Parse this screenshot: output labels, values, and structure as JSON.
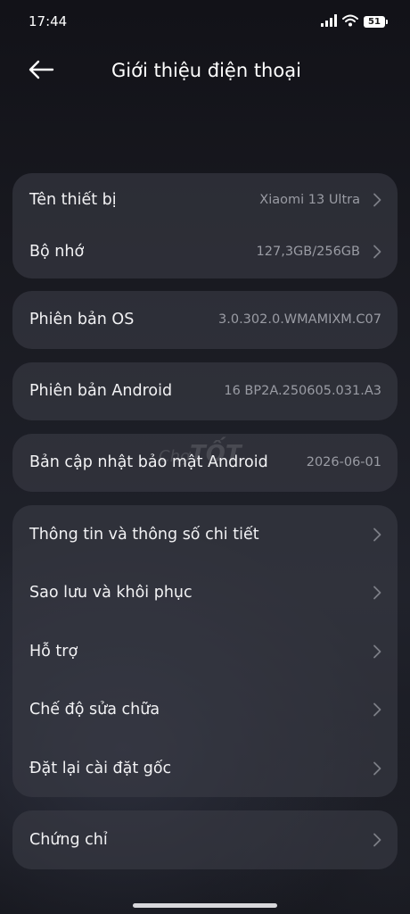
{
  "status_bar": {
    "time": "17:44",
    "battery_level": "51",
    "icons": [
      "signal-icon",
      "wifi-icon",
      "battery-icon"
    ]
  },
  "header": {
    "back_icon": "arrow-left-icon",
    "title": "Giới thiệu điện thoại"
  },
  "cards": {
    "device": {
      "rows": [
        {
          "label": "Tên thiết bị",
          "value": "Xiaomi 13 Ultra"
        },
        {
          "label": "Bộ nhớ",
          "value": "127,3GB/256GB"
        }
      ]
    },
    "os": {
      "label": "Phiên bản OS",
      "value": "3.0.302.0.WMAMIXM.C07"
    },
    "android": {
      "label": "Phiên bản Android",
      "value": "16 BP2A.250605.031.A3"
    },
    "security": {
      "label": "Bản cập nhật bảo mật Android",
      "value": "2026-06-01"
    },
    "more": {
      "rows": [
        {
          "label": "Thông tin và thông số chi tiết"
        },
        {
          "label": "Sao lưu và khôi phục"
        },
        {
          "label": "Hỗ trợ"
        },
        {
          "label": "Chế độ sửa chữa"
        },
        {
          "label": "Đặt lại cài đặt gốc"
        }
      ]
    },
    "certificate": {
      "label": "Chứng chỉ"
    }
  },
  "watermark": {
    "prefix": "Chợ",
    "brand": "TỐT"
  },
  "colors": {
    "background": "#1a1b22",
    "card": "#3a3c46",
    "label": "#f2f2f4",
    "value": "#9a9ca4",
    "chevron": "#7c7e86"
  }
}
